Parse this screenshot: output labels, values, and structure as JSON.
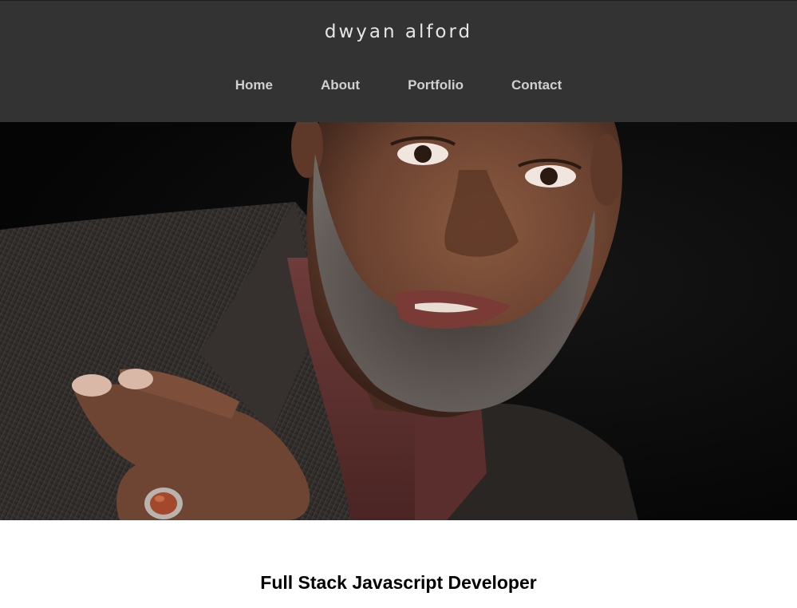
{
  "header": {
    "site_title": "dwyan alford",
    "background": "#333333"
  },
  "nav": {
    "items": [
      {
        "label": "Home"
      },
      {
        "label": "About"
      },
      {
        "label": "Portfolio"
      },
      {
        "label": "Contact"
      }
    ]
  },
  "hero": {
    "image_icon": "portrait-photo"
  },
  "main": {
    "tagline": "Full Stack Javascript Developer"
  }
}
